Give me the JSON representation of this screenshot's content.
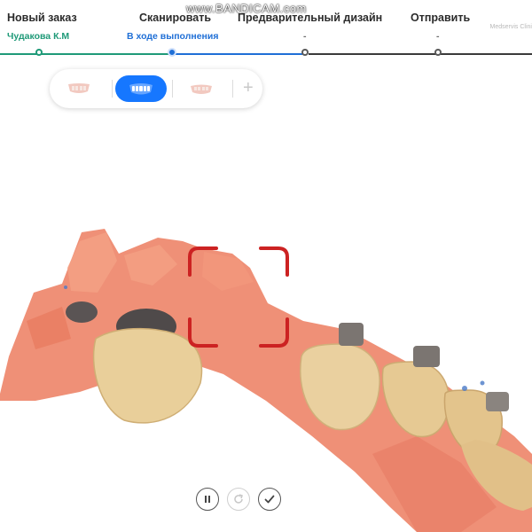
{
  "watermark": "www.BANDICAM.com",
  "brand": "Medservis Clini",
  "steps": [
    {
      "title": "Новый заказ",
      "sub": "Чудакова К.М"
    },
    {
      "title": "Сканировать",
      "sub": "В ходе выполнения"
    },
    {
      "title": "Предварительный дизайн",
      "sub": "-"
    },
    {
      "title": "Отправить",
      "sub": "-"
    }
  ],
  "mode_bar": {
    "modes": [
      {
        "icon": "upper-jaw-icon",
        "active": false
      },
      {
        "icon": "lower-jaw-icon",
        "active": true
      },
      {
        "icon": "bite-icon",
        "active": false
      }
    ],
    "add": "+"
  },
  "controls": [
    {
      "icon": "pause-icon",
      "enabled": true
    },
    {
      "icon": "redo-icon",
      "enabled": false
    },
    {
      "icon": "check-icon",
      "enabled": true
    }
  ],
  "colors": {
    "done": "#1f9a78",
    "active": "#1f6fd6",
    "mode_active": "#1677ff",
    "scan_frame": "#cc2222",
    "gum": "#ee8a70",
    "tooth": "#e9cf9a"
  }
}
